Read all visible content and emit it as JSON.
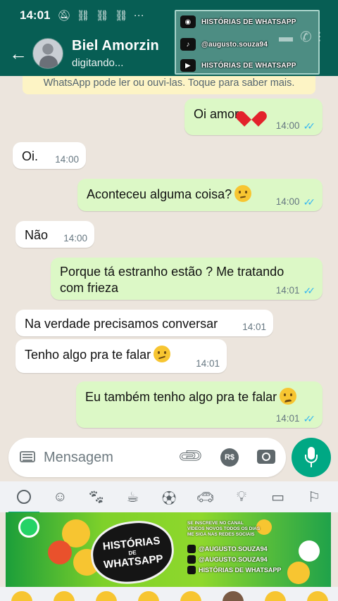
{
  "status_bar": {
    "time": "14:01",
    "icons": [
      "mute-icon",
      "sim-icon",
      "sim-icon",
      "sim-icon"
    ],
    "more": "···"
  },
  "header": {
    "contact_name": "Biel Amorzin",
    "contact_status": "digitando..."
  },
  "watermark": {
    "line1": "HISTÓRIAS DE WHATSAPP",
    "line2": "@augusto.souza94",
    "line3": "HISTÓRIAS DE WHATSAPP"
  },
  "chat": {
    "encryption_notice": "WhatsApp pode ler ou ouvi-las. Toque para saber mais.",
    "messages": [
      {
        "dir": "out",
        "text": "Oi amor",
        "emoji": "heart",
        "time": "14:00"
      },
      {
        "dir": "in",
        "text": "Oi.",
        "time": "14:00"
      },
      {
        "dir": "out",
        "text": "Aconteceu alguma coisa?",
        "emoji": "thinking-face",
        "time": "14:00"
      },
      {
        "dir": "in",
        "text": "Não",
        "time": "14:00"
      },
      {
        "dir": "out",
        "text": "Porque tá estranho estão ? Me tratando",
        "text2": "com frieza",
        "time": "14:01"
      },
      {
        "dir": "in",
        "text": "Na verdade precisamos conversar",
        "time": "14:01"
      },
      {
        "dir": "in",
        "text": "Tenho algo pra te falar",
        "emoji": "confused-face",
        "time": "14:01"
      },
      {
        "dir": "out",
        "text": "Eu também tenho algo pra te falar",
        "emoji": "disappointed-face",
        "time": "14:01"
      }
    ]
  },
  "input": {
    "placeholder": "Mensagem",
    "pay_label": "R$"
  },
  "emoji_tabs": [
    "recent-icon",
    "smiley-icon",
    "animal-icon",
    "food-icon",
    "sports-icon",
    "travel-icon",
    "objects-icon",
    "symbols-icon",
    "flags-icon"
  ],
  "banner": {
    "title_line1": "HISTÓRIAS",
    "title_de": "DE",
    "title_line2": "WHATSAPP",
    "info1": "SE INSCREVE NO CANAL",
    "info2": "VÍDEOS NOVOS TODOS OS DIAS",
    "info3": "ME SIGA NAS REDES SOCIAIS",
    "instagram": "@AUGUSTO.SOUZA94",
    "tiktok": "@AUGUSTO.SOUZA94",
    "youtube": "HISTÓRIAS DE WHATSAPP"
  },
  "colors": {
    "header": "#075e54",
    "outgoing": "#dcf8c6",
    "incoming": "#ffffff",
    "accent": "#00a884",
    "ticks": "#34b7f1"
  }
}
